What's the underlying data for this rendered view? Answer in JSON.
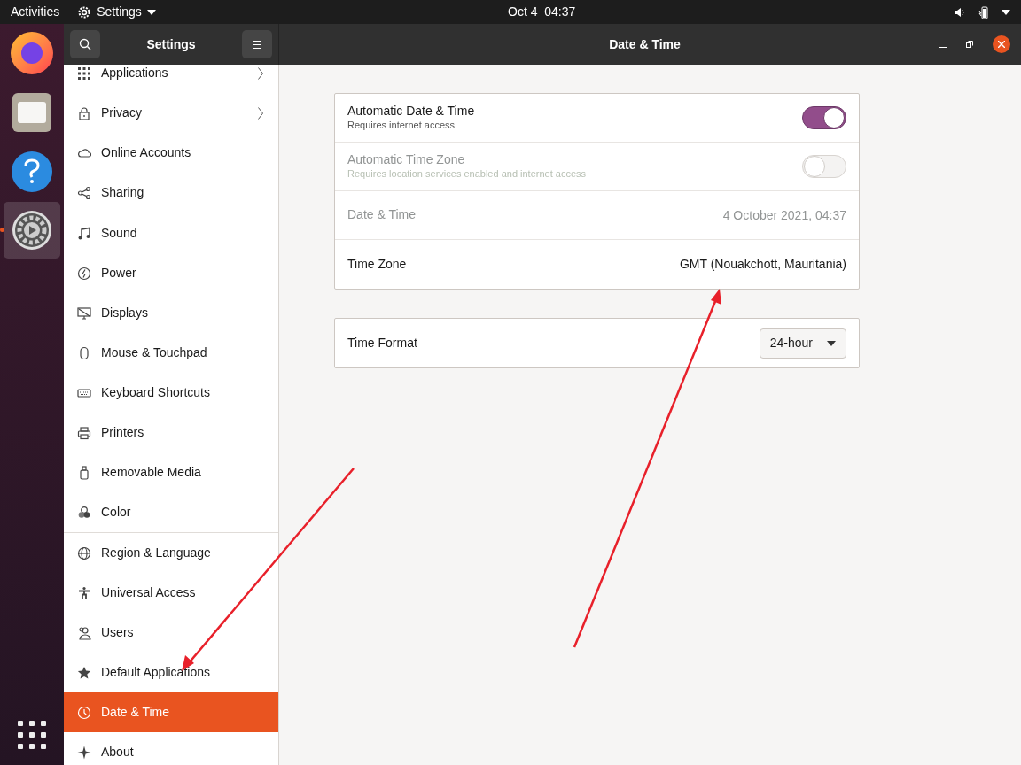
{
  "top_bar": {
    "activities": "Activities",
    "app_menu": "Settings",
    "clock": "Oct 4  04:37"
  },
  "header": {
    "sidebar_title": "Settings",
    "title": "Date & Time"
  },
  "sidebar": {
    "groups": [
      [
        {
          "label": "Applications",
          "selected": false,
          "arrow": true
        },
        {
          "label": "Privacy",
          "selected": false,
          "arrow": true
        },
        {
          "label": "Online Accounts",
          "selected": false,
          "arrow": false
        },
        {
          "label": "Sharing",
          "selected": false,
          "arrow": false
        }
      ],
      [
        {
          "label": "Sound",
          "selected": false,
          "arrow": false
        },
        {
          "label": "Power",
          "selected": false,
          "arrow": false
        },
        {
          "label": "Displays",
          "selected": false,
          "arrow": false
        },
        {
          "label": "Mouse & Touchpad",
          "selected": false,
          "arrow": false
        },
        {
          "label": "Keyboard Shortcuts",
          "selected": false,
          "arrow": false
        },
        {
          "label": "Printers",
          "selected": false,
          "arrow": false
        },
        {
          "label": "Removable Media",
          "selected": false,
          "arrow": false
        },
        {
          "label": "Color",
          "selected": false,
          "arrow": false
        }
      ],
      [
        {
          "label": "Region & Language",
          "selected": false,
          "arrow": false
        },
        {
          "label": "Universal Access",
          "selected": false,
          "arrow": false
        },
        {
          "label": "Users",
          "selected": false,
          "arrow": false
        },
        {
          "label": "Default Applications",
          "selected": false,
          "arrow": false
        },
        {
          "label": "Date & Time",
          "selected": true,
          "arrow": false
        },
        {
          "label": "About",
          "selected": false,
          "arrow": false
        }
      ]
    ]
  },
  "panels": [
    [
      {
        "kind": "switch",
        "title": "Automatic Date & Time",
        "subtitle": "Requires internet access",
        "on": true,
        "disabled": false
      },
      {
        "kind": "switch",
        "title": "Automatic Time Zone",
        "subtitle": "Requires location services enabled and internet access",
        "on": false,
        "disabled": true
      },
      {
        "kind": "value",
        "title": "Date & Time",
        "value": "4 October 2021, 04:37",
        "disabled": true
      },
      {
        "kind": "value",
        "title": "Time Zone",
        "value": "GMT (Nouakchott, Mauritania)",
        "disabled": false
      }
    ],
    [
      {
        "kind": "dropdown",
        "title": "Time Format",
        "value": "24-hour",
        "disabled": false
      }
    ]
  ]
}
